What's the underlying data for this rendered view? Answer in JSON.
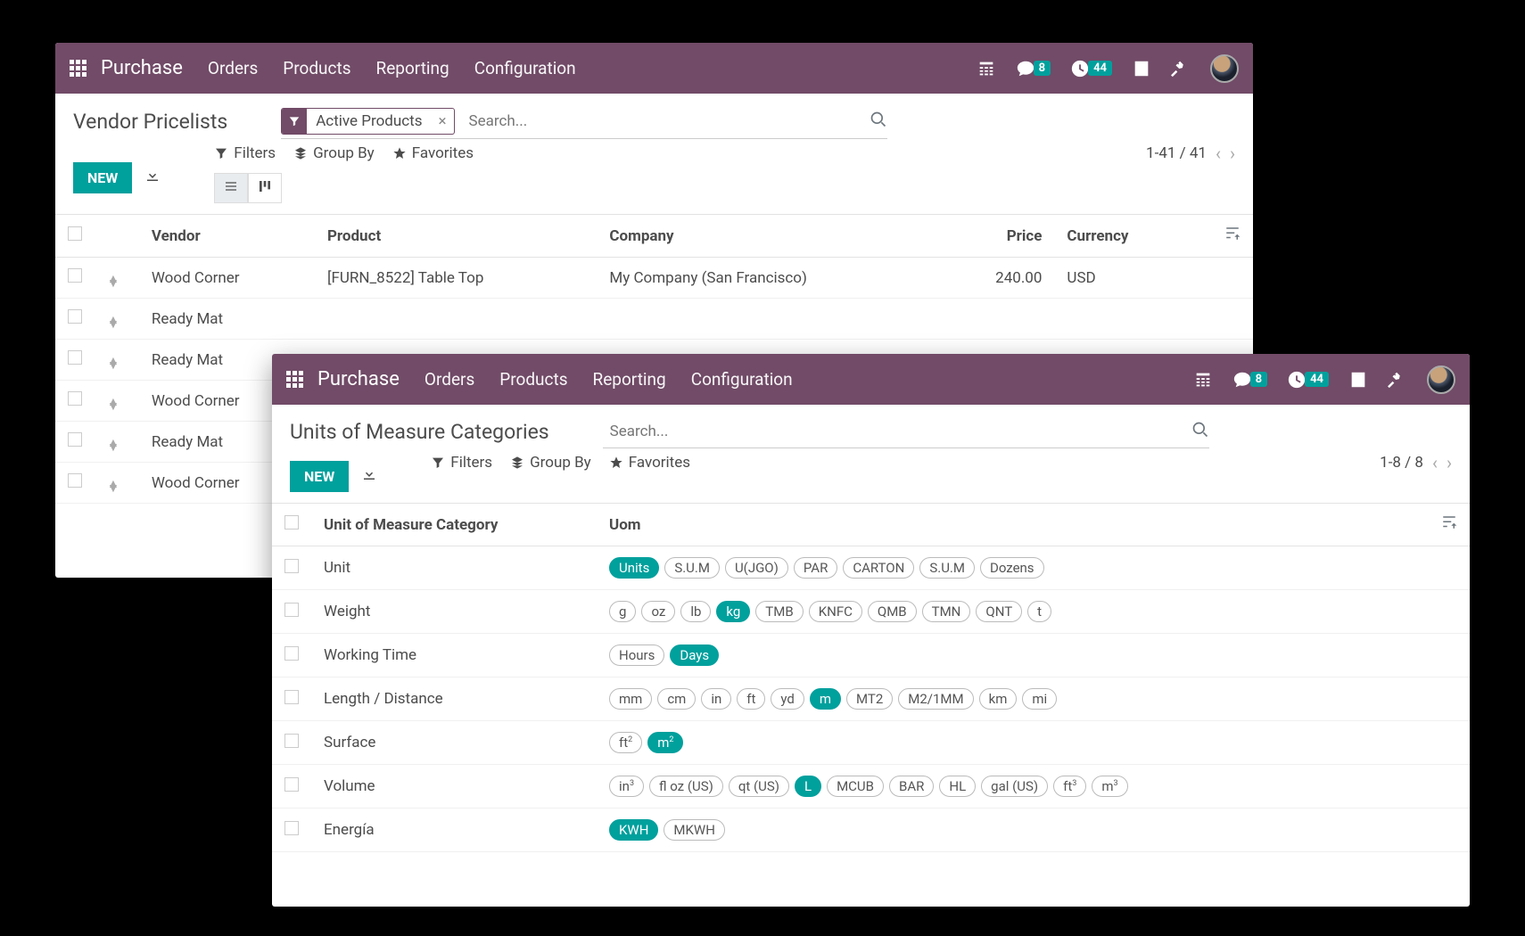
{
  "top": {
    "app": "Purchase",
    "nav": [
      "Orders",
      "Products",
      "Reporting",
      "Configuration"
    ],
    "msg_count": "8",
    "activity_count": "44"
  },
  "window1": {
    "title": "Vendor Pricelists",
    "new_label": "NEW",
    "filter_chip": "Active Products",
    "search_placeholder": "Search...",
    "filters_label": "Filters",
    "groupby_label": "Group By",
    "favorites_label": "Favorites",
    "pager": "1-41 / 41",
    "cols": {
      "vendor": "Vendor",
      "product": "Product",
      "company": "Company",
      "price": "Price",
      "currency": "Currency"
    },
    "rows": [
      {
        "vendor": "Wood Corner",
        "product": "[FURN_8522] Table Top",
        "company": "My Company (San Francisco)",
        "price": "240.00",
        "currency": "USD"
      },
      {
        "vendor": "Ready Mat",
        "product": "",
        "company": "",
        "price": "",
        "currency": ""
      },
      {
        "vendor": "Ready Mat",
        "product": "",
        "company": "",
        "price": "",
        "currency": ""
      },
      {
        "vendor": "Wood Corner",
        "product": "",
        "company": "",
        "price": "",
        "currency": ""
      },
      {
        "vendor": "Ready Mat",
        "product": "",
        "company": "",
        "price": "",
        "currency": ""
      },
      {
        "vendor": "Wood Corner",
        "product": "",
        "company": "",
        "price": "",
        "currency": ""
      }
    ]
  },
  "window2": {
    "title": "Units of Measure Categories",
    "new_label": "NEW",
    "search_placeholder": "Search...",
    "filters_label": "Filters",
    "groupby_label": "Group By",
    "favorites_label": "Favorites",
    "pager": "1-8 / 8",
    "cols": {
      "category": "Unit of Measure Category",
      "uom": "Uom"
    },
    "rows": [
      {
        "cat": "Unit",
        "chips": [
          {
            "t": "Units",
            "f": true
          },
          {
            "t": "S.U.M"
          },
          {
            "t": "U(JGO)"
          },
          {
            "t": "PAR"
          },
          {
            "t": "CARTON"
          },
          {
            "t": "S.U.M"
          },
          {
            "t": "Dozens"
          }
        ]
      },
      {
        "cat": "Weight",
        "chips": [
          {
            "t": "g"
          },
          {
            "t": "oz"
          },
          {
            "t": "lb"
          },
          {
            "t": "kg",
            "f": true
          },
          {
            "t": "TMB"
          },
          {
            "t": "KNFC"
          },
          {
            "t": "QMB"
          },
          {
            "t": "TMN"
          },
          {
            "t": "QNT"
          },
          {
            "t": "t"
          }
        ]
      },
      {
        "cat": "Working Time",
        "chips": [
          {
            "t": "Hours"
          },
          {
            "t": "Days",
            "f": true
          }
        ]
      },
      {
        "cat": "Length / Distance",
        "chips": [
          {
            "t": "mm"
          },
          {
            "t": "cm"
          },
          {
            "t": "in"
          },
          {
            "t": "ft"
          },
          {
            "t": "yd"
          },
          {
            "t": "m",
            "f": true
          },
          {
            "t": "MT2"
          },
          {
            "t": "M2/1MM"
          },
          {
            "t": "km"
          },
          {
            "t": "mi"
          }
        ]
      },
      {
        "cat": "Surface",
        "chips": [
          {
            "t": "ft²"
          },
          {
            "t": "m²",
            "f": true
          }
        ]
      },
      {
        "cat": "Volume",
        "chips": [
          {
            "t": "in³"
          },
          {
            "t": "fl oz (US)"
          },
          {
            "t": "qt (US)"
          },
          {
            "t": "L",
            "f": true
          },
          {
            "t": "MCUB"
          },
          {
            "t": "BAR"
          },
          {
            "t": "HL"
          },
          {
            "t": "gal (US)"
          },
          {
            "t": "ft³"
          },
          {
            "t": "m³"
          }
        ]
      },
      {
        "cat": "Energía",
        "chips": [
          {
            "t": "KWH",
            "f": true
          },
          {
            "t": "MKWH"
          }
        ]
      }
    ]
  }
}
